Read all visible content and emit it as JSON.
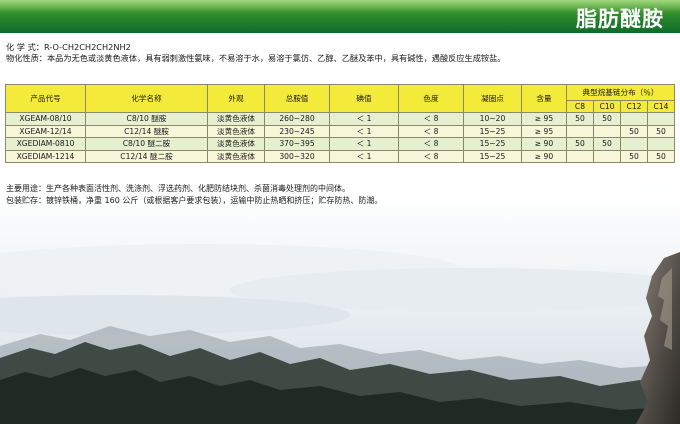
{
  "header": {
    "title": "脂肪醚胺"
  },
  "info": {
    "formula_label": "化 学 式：",
    "formula_value": "R-O-CH2CH2CH2NH2",
    "property_label": "物化性质：",
    "property_value": "本品为无色或淡黄色液体，具有弱刺激性氨味，不易溶于水，易溶于氯仿、乙醇、乙醚及苯中，具有碱性，遇酸反应生成铵盐。"
  },
  "table": {
    "headers": {
      "code": "产品代号",
      "name": "化学名称",
      "appearance": "外观",
      "total_amine": "总胺值",
      "iodine": "碘值",
      "color": "色度",
      "freezing_point": "凝固点",
      "content": "含量",
      "chain_dist": "典型烷基链分布（％）",
      "c8": "C8",
      "c10": "C10",
      "c12": "C12",
      "c14": "C14"
    },
    "rows": [
      {
        "code": "XGEAM-08/10",
        "name": "C8/10 醚胺",
        "appearance": "淡黄色液体",
        "total_amine": "260~280",
        "iodine": "＜ 1",
        "color": "＜ 8",
        "freezing_point": "10~20",
        "content": "≥ 95",
        "c8": "50",
        "c10": "50",
        "c12": "",
        "c14": ""
      },
      {
        "code": "XGEAM-12/14",
        "name": "C12/14 醚胺",
        "appearance": "淡黄色液体",
        "total_amine": "230~245",
        "iodine": "＜ 1",
        "color": "＜ 8",
        "freezing_point": "15~25",
        "content": "≥ 95",
        "c8": "",
        "c10": "",
        "c12": "50",
        "c14": "50"
      },
      {
        "code": "XGEDIAM-0810",
        "name": "C8/10 醚二胺",
        "appearance": "淡黄色液体",
        "total_amine": "370~395",
        "iodine": "＜ 1",
        "color": "＜ 8",
        "freezing_point": "15~25",
        "content": "≥ 90",
        "c8": "50",
        "c10": "50",
        "c12": "",
        "c14": ""
      },
      {
        "code": "XGEDIAM-1214",
        "name": "C12/14 醚二胺",
        "appearance": "淡黄色液体",
        "total_amine": "300~320",
        "iodine": "＜ 1",
        "color": "＜ 8",
        "freezing_point": "15~25",
        "content": "≥ 90",
        "c8": "",
        "c10": "",
        "c12": "50",
        "c14": "50"
      }
    ]
  },
  "notes": {
    "use_label": "主要用途：",
    "use_value": "生产各种表面活性剂、洗涤剂、浮选药剂、化肥防结块剂、杀菌消毒处理剂的中间体。",
    "storage_label": "包装贮存：",
    "storage_value": "镀锌铁桶，净重 160 公斤（或根据客户要求包装），运输中防止热晒和挤压；贮存防热、防潮。"
  }
}
